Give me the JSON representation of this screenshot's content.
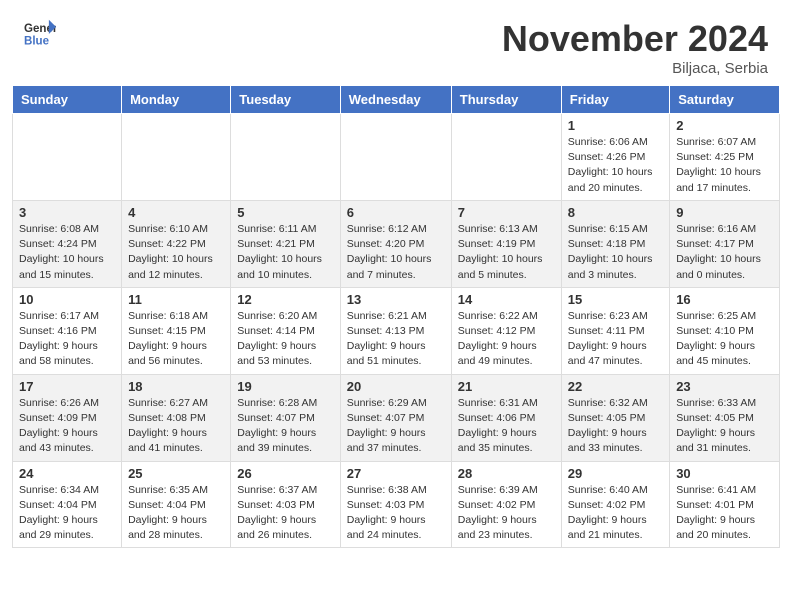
{
  "header": {
    "logo_general": "General",
    "logo_blue": "Blue",
    "title": "November 2024",
    "location": "Biljaca, Serbia"
  },
  "days_of_week": [
    "Sunday",
    "Monday",
    "Tuesday",
    "Wednesday",
    "Thursday",
    "Friday",
    "Saturday"
  ],
  "weeks": [
    [
      {
        "day": "",
        "info": ""
      },
      {
        "day": "",
        "info": ""
      },
      {
        "day": "",
        "info": ""
      },
      {
        "day": "",
        "info": ""
      },
      {
        "day": "",
        "info": ""
      },
      {
        "day": "1",
        "info": "Sunrise: 6:06 AM\nSunset: 4:26 PM\nDaylight: 10 hours and 20 minutes."
      },
      {
        "day": "2",
        "info": "Sunrise: 6:07 AM\nSunset: 4:25 PM\nDaylight: 10 hours and 17 minutes."
      }
    ],
    [
      {
        "day": "3",
        "info": "Sunrise: 6:08 AM\nSunset: 4:24 PM\nDaylight: 10 hours and 15 minutes."
      },
      {
        "day": "4",
        "info": "Sunrise: 6:10 AM\nSunset: 4:22 PM\nDaylight: 10 hours and 12 minutes."
      },
      {
        "day": "5",
        "info": "Sunrise: 6:11 AM\nSunset: 4:21 PM\nDaylight: 10 hours and 10 minutes."
      },
      {
        "day": "6",
        "info": "Sunrise: 6:12 AM\nSunset: 4:20 PM\nDaylight: 10 hours and 7 minutes."
      },
      {
        "day": "7",
        "info": "Sunrise: 6:13 AM\nSunset: 4:19 PM\nDaylight: 10 hours and 5 minutes."
      },
      {
        "day": "8",
        "info": "Sunrise: 6:15 AM\nSunset: 4:18 PM\nDaylight: 10 hours and 3 minutes."
      },
      {
        "day": "9",
        "info": "Sunrise: 6:16 AM\nSunset: 4:17 PM\nDaylight: 10 hours and 0 minutes."
      }
    ],
    [
      {
        "day": "10",
        "info": "Sunrise: 6:17 AM\nSunset: 4:16 PM\nDaylight: 9 hours and 58 minutes."
      },
      {
        "day": "11",
        "info": "Sunrise: 6:18 AM\nSunset: 4:15 PM\nDaylight: 9 hours and 56 minutes."
      },
      {
        "day": "12",
        "info": "Sunrise: 6:20 AM\nSunset: 4:14 PM\nDaylight: 9 hours and 53 minutes."
      },
      {
        "day": "13",
        "info": "Sunrise: 6:21 AM\nSunset: 4:13 PM\nDaylight: 9 hours and 51 minutes."
      },
      {
        "day": "14",
        "info": "Sunrise: 6:22 AM\nSunset: 4:12 PM\nDaylight: 9 hours and 49 minutes."
      },
      {
        "day": "15",
        "info": "Sunrise: 6:23 AM\nSunset: 4:11 PM\nDaylight: 9 hours and 47 minutes."
      },
      {
        "day": "16",
        "info": "Sunrise: 6:25 AM\nSunset: 4:10 PM\nDaylight: 9 hours and 45 minutes."
      }
    ],
    [
      {
        "day": "17",
        "info": "Sunrise: 6:26 AM\nSunset: 4:09 PM\nDaylight: 9 hours and 43 minutes."
      },
      {
        "day": "18",
        "info": "Sunrise: 6:27 AM\nSunset: 4:08 PM\nDaylight: 9 hours and 41 minutes."
      },
      {
        "day": "19",
        "info": "Sunrise: 6:28 AM\nSunset: 4:07 PM\nDaylight: 9 hours and 39 minutes."
      },
      {
        "day": "20",
        "info": "Sunrise: 6:29 AM\nSunset: 4:07 PM\nDaylight: 9 hours and 37 minutes."
      },
      {
        "day": "21",
        "info": "Sunrise: 6:31 AM\nSunset: 4:06 PM\nDaylight: 9 hours and 35 minutes."
      },
      {
        "day": "22",
        "info": "Sunrise: 6:32 AM\nSunset: 4:05 PM\nDaylight: 9 hours and 33 minutes."
      },
      {
        "day": "23",
        "info": "Sunrise: 6:33 AM\nSunset: 4:05 PM\nDaylight: 9 hours and 31 minutes."
      }
    ],
    [
      {
        "day": "24",
        "info": "Sunrise: 6:34 AM\nSunset: 4:04 PM\nDaylight: 9 hours and 29 minutes."
      },
      {
        "day": "25",
        "info": "Sunrise: 6:35 AM\nSunset: 4:04 PM\nDaylight: 9 hours and 28 minutes."
      },
      {
        "day": "26",
        "info": "Sunrise: 6:37 AM\nSunset: 4:03 PM\nDaylight: 9 hours and 26 minutes."
      },
      {
        "day": "27",
        "info": "Sunrise: 6:38 AM\nSunset: 4:03 PM\nDaylight: 9 hours and 24 minutes."
      },
      {
        "day": "28",
        "info": "Sunrise: 6:39 AM\nSunset: 4:02 PM\nDaylight: 9 hours and 23 minutes."
      },
      {
        "day": "29",
        "info": "Sunrise: 6:40 AM\nSunset: 4:02 PM\nDaylight: 9 hours and 21 minutes."
      },
      {
        "day": "30",
        "info": "Sunrise: 6:41 AM\nSunset: 4:01 PM\nDaylight: 9 hours and 20 minutes."
      }
    ]
  ]
}
